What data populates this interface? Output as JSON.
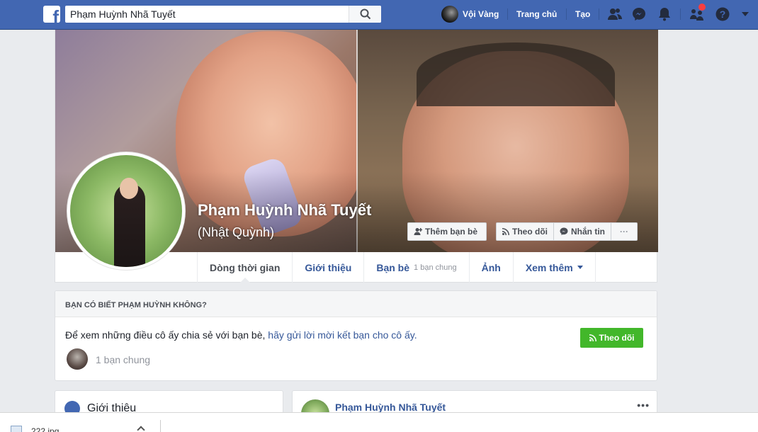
{
  "topbar": {
    "search_value": "Phạm Huỳnh Nhã Tuyết",
    "user_name": "Vội Vàng",
    "home_label": "Trang chủ",
    "create_label": "Tạo",
    "brand_color": "#4267b2"
  },
  "profile": {
    "name": "Phạm Huỳnh Nhã Tuyết",
    "alternate_name": "(Nhật Quỳnh)",
    "buttons": {
      "add_friend": "Thêm bạn bè",
      "follow": "Theo dõi",
      "message": "Nhắn tin",
      "more": "···"
    }
  },
  "tabs": [
    {
      "label": "Dòng thời gian",
      "active": true
    },
    {
      "label": "Giới thiệu"
    },
    {
      "label": "Bạn bè",
      "sub": "1 bạn chung"
    },
    {
      "label": "Ảnh"
    },
    {
      "label": "Xem thêm"
    }
  ],
  "know_card": {
    "heading": "BẠN CÓ BIẾT PHẠM HUỲNH KHÔNG?",
    "text_prefix": "Để xem những điều cô ấy chia sẻ với bạn bè, ",
    "text_link": "hãy gửi lời mời kết bạn cho cô ấy.",
    "follow_button": "Theo dõi",
    "mutual_friends": "1 bạn chung",
    "follow_color": "#42b72a"
  },
  "intro": {
    "title": "Giới thiệu"
  },
  "post": {
    "author": "Phạm Huỳnh Nhã Tuyết",
    "more": "•••"
  },
  "download": {
    "file_name": "222.jpg"
  }
}
